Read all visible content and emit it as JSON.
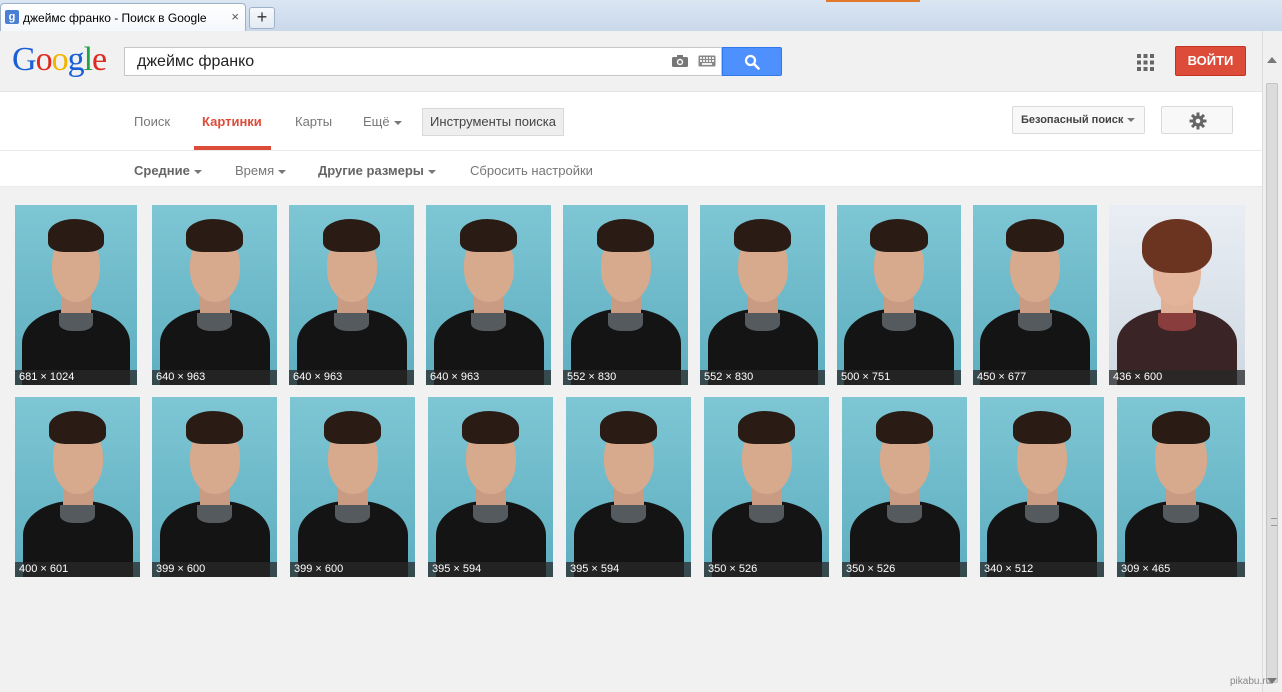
{
  "browser": {
    "tab_title": "джеймс франко - Поиск в Google",
    "favicon_letter": "g",
    "close_glyph": "×",
    "new_tab_glyph": "+"
  },
  "header": {
    "logo_letters": [
      "G",
      "o",
      "o",
      "g",
      "l",
      "e"
    ],
    "logo_colors": [
      "#1a5fd8",
      "#dd2a20",
      "#f2b400",
      "#1a5fd8",
      "#1fa347",
      "#dd2a20"
    ],
    "search_value": "джеймс франко",
    "signin_label": "ВОЙТИ",
    "icons": [
      "camera-icon",
      "keyboard-icon",
      "search-icon",
      "apps-grid-icon"
    ]
  },
  "nav": {
    "items": [
      "Поиск",
      "Картинки",
      "Карты",
      "Ещё"
    ],
    "active": "Картинки",
    "tools_label": "Инструменты поиска",
    "safesearch_label": "Безопасный поиск",
    "settings_icon": "gear-icon"
  },
  "tools": {
    "items": [
      "Средние",
      "Время",
      "Другие размеры",
      "Сбросить настройки"
    ]
  },
  "results": {
    "row1": [
      "681 × 1024",
      "640 × 963",
      "640 × 963",
      "640 × 963",
      "552 × 830",
      "552 × 830",
      "500 × 751",
      "450 × 677",
      "436 × 600"
    ],
    "row2": [
      "400 × 601",
      "399 × 600",
      "399 × 600",
      "395 × 594",
      "395 × 594",
      "350 × 526",
      "350 × 526",
      "340 × 512",
      "309 × 465"
    ]
  },
  "watermark": "pikabu.ru"
}
